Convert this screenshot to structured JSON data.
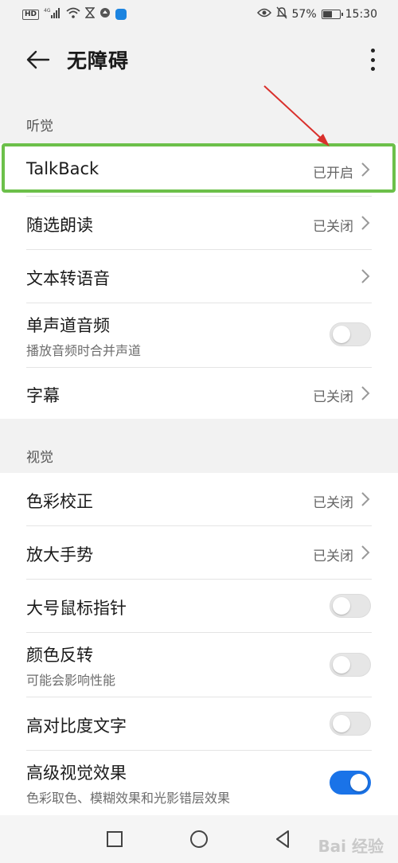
{
  "status_bar": {
    "network": "HD",
    "signal": "4G",
    "battery_percent": "57%",
    "battery_level": 0.57,
    "time": "15:30",
    "icons": [
      "hd-icon",
      "signal-icon",
      "wifi-icon",
      "hourglass-icon",
      "app-icon",
      "app-icon-2",
      "eye-icon",
      "mute-icon",
      "battery-icon"
    ]
  },
  "header": {
    "title": "无障碍"
  },
  "sections": {
    "hearing": {
      "label": "听觉",
      "items": [
        {
          "title": "TalkBack",
          "status": "已开启"
        },
        {
          "title": "随选朗读",
          "status": "已关闭"
        },
        {
          "title": "文本转语音",
          "status": ""
        },
        {
          "title": "单声道音频",
          "subtitle": "播放音频时合并声道",
          "toggle": false
        },
        {
          "title": "字幕",
          "status": "已关闭"
        }
      ]
    },
    "vision": {
      "label": "视觉",
      "items": [
        {
          "title": "色彩校正",
          "status": "已关闭"
        },
        {
          "title": "放大手势",
          "status": "已关闭"
        },
        {
          "title": "大号鼠标指针",
          "toggle": false
        },
        {
          "title": "颜色反转",
          "subtitle": "可能会影响性能",
          "toggle": false
        },
        {
          "title": "高对比度文字",
          "toggle": false
        },
        {
          "title": "高级视觉效果",
          "subtitle": "色彩取色、模糊效果和光影错层效果",
          "toggle": true
        }
      ]
    }
  },
  "annotations": {
    "highlight_color": "#6cc04a",
    "arrow_color": "#d9302c"
  },
  "watermark": "Bai 经验"
}
